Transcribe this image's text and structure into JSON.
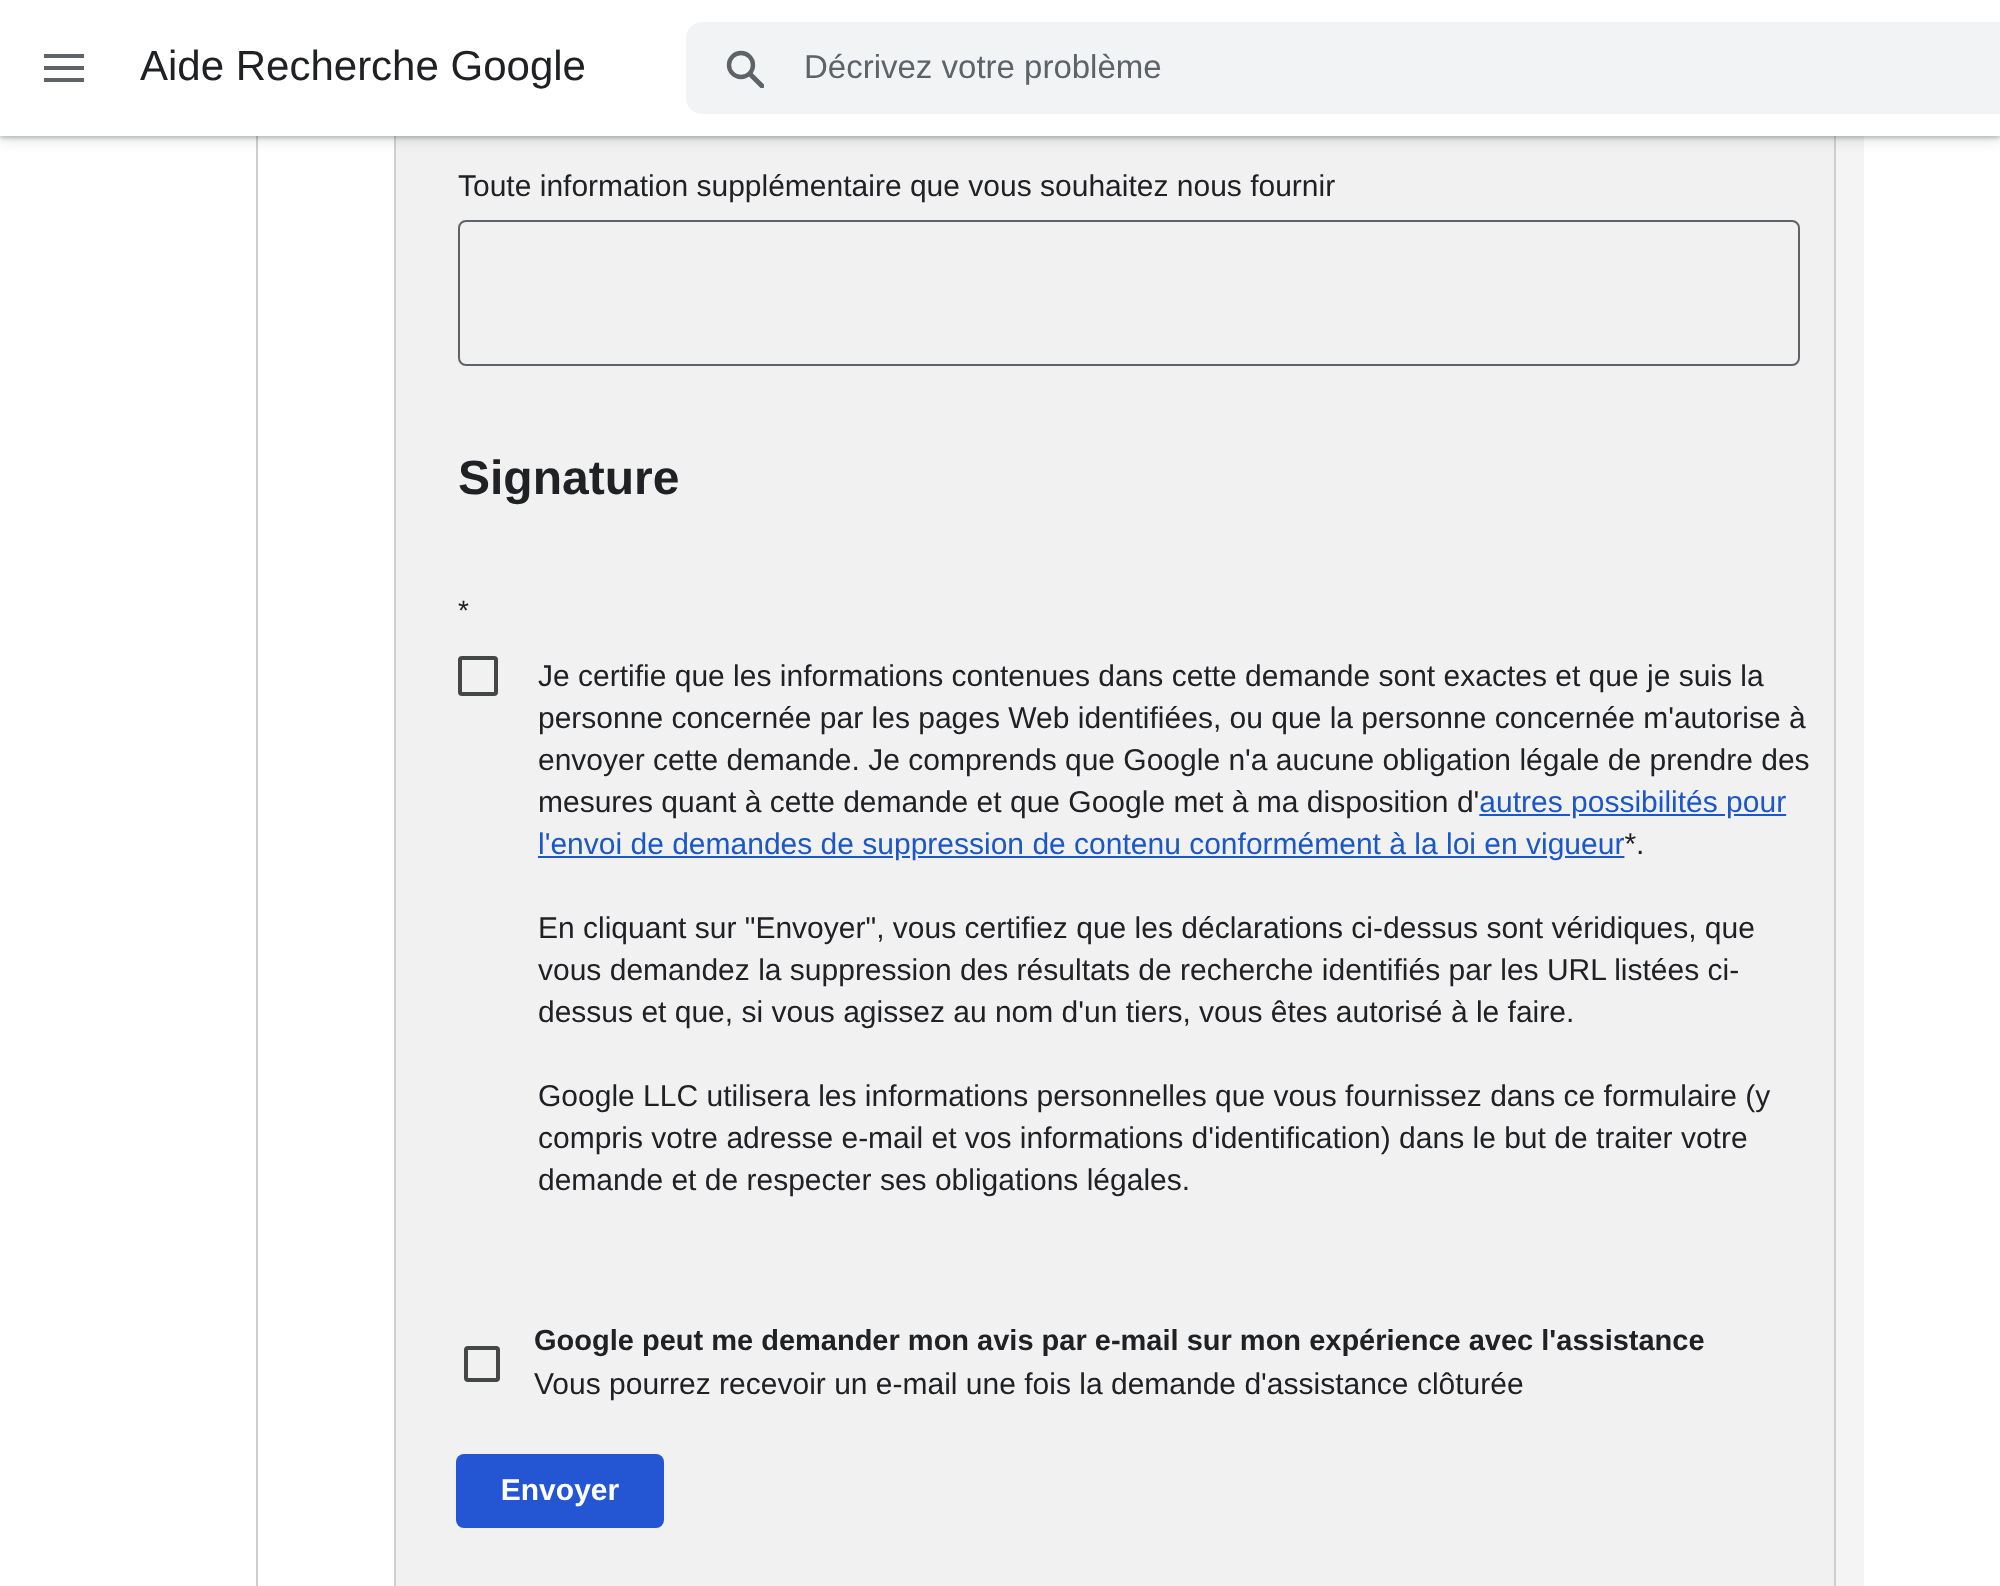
{
  "header": {
    "title": "Aide Recherche Google",
    "search": {
      "placeholder": "Décrivez votre problème"
    }
  },
  "form": {
    "additional_info": {
      "label": "Toute information supplémentaire que vous souhaitez nous fournir"
    },
    "signature": {
      "heading": "Signature",
      "required_mark": "*",
      "certification": {
        "checked": false,
        "text_before": "Je certifie que les informations contenues dans cette demande sont exactes et que je suis la personne concernée par les pages Web identifiées, ou que la personne concernée m'autorise à envoyer cette demande. Je comprends que Google n'a aucune obligation légale de prendre des mesures quant à cette demande et que Google met à ma disposition d'",
        "link_parts": [
          "autres possibilités pour",
          "l'envoi de demandes de suppression de contenu conformément à la loi en vigueur"
        ],
        "text_after": "*."
      },
      "paragraphs": [
        "En cliquant sur \"Envoyer\", vous certifiez que les déclarations ci-dessus sont véridiques, que vous demandez la suppression des résultats de recherche identifiés par les URL listées ci-dessus et que, si vous agissez au nom d'un tiers, vous êtes autorisé à le faire.",
        "Google LLC utilisera les informations personnelles que vous fournissez dans ce formulaire (y compris votre adresse e-mail et vos informations d'identification) dans le but de traiter votre demande et de respecter ses obligations légales."
      ]
    },
    "feedback": {
      "checked": false,
      "label": "Google peut me demander mon avis par e-mail sur mon expérience avec l'assistance",
      "description": "Vous pourrez recevoir un e-mail une fois la demande d'assistance clôturée"
    },
    "submit": "Envoyer"
  }
}
